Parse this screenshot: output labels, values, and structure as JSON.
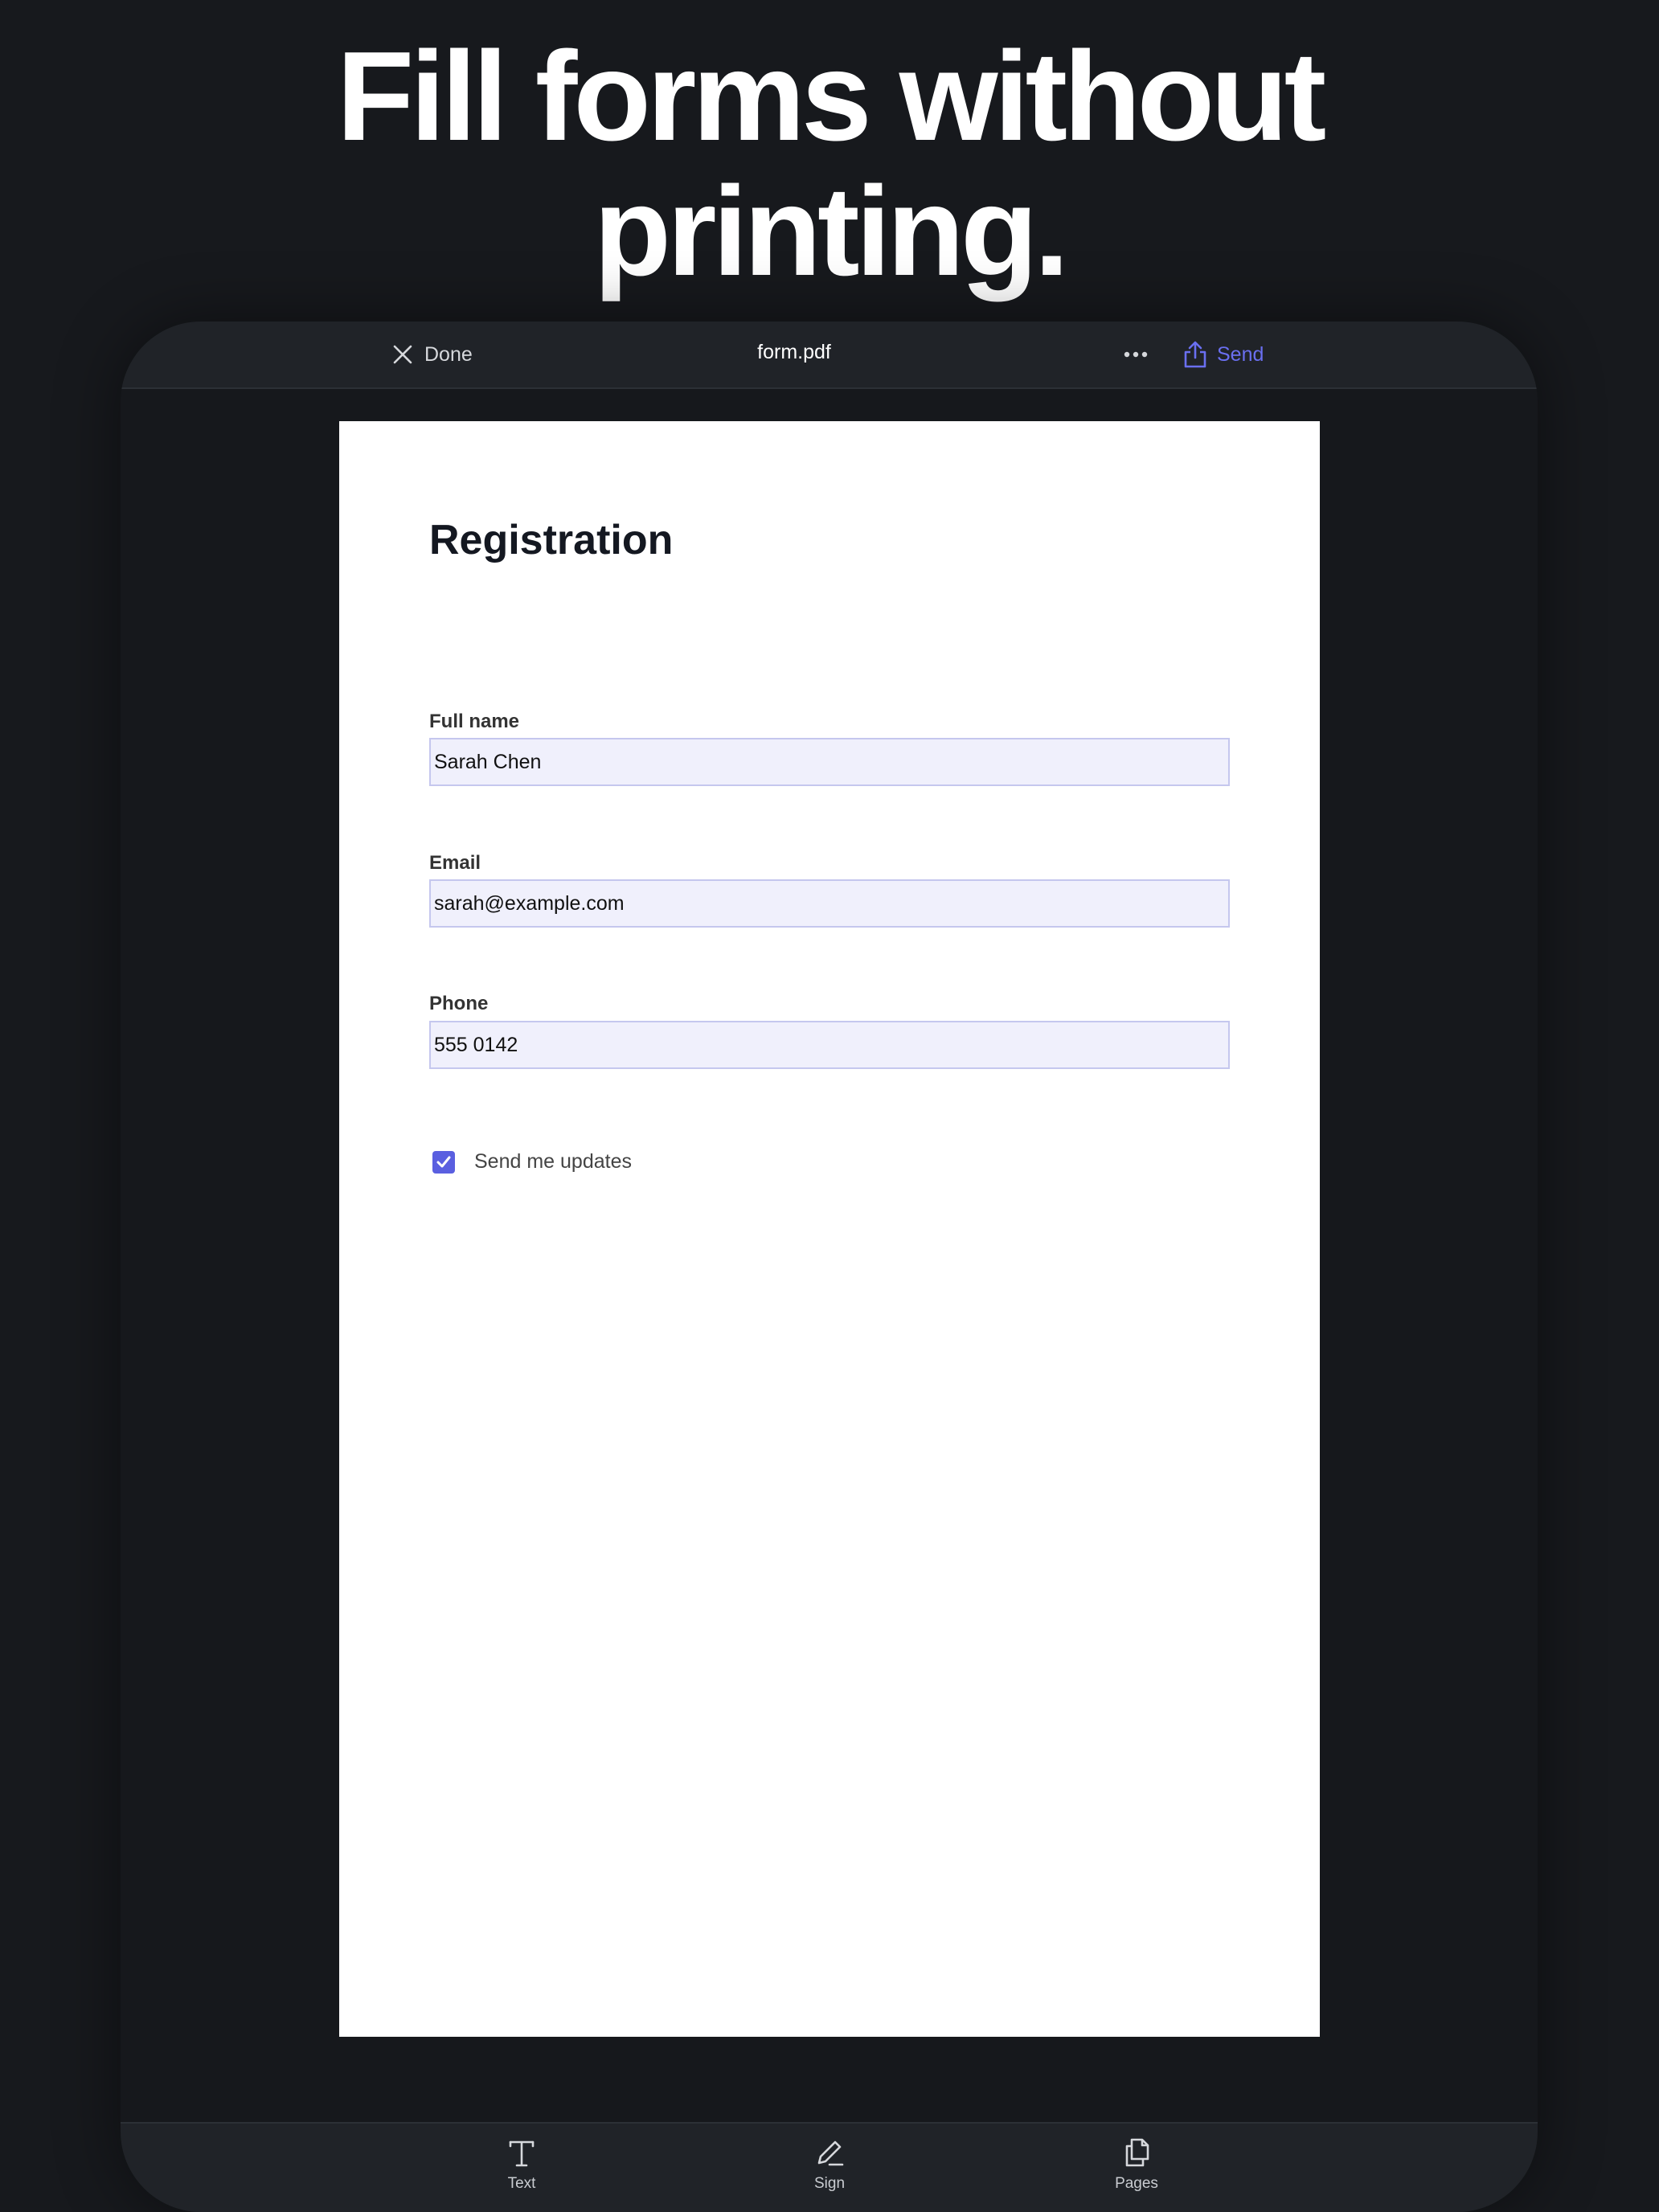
{
  "headline": {
    "line1": "Fill forms without",
    "line2": "printing."
  },
  "topbar": {
    "done_label": "Done",
    "document_title": "form.pdf",
    "more_icon": "ellipsis-icon",
    "send_label": "Send"
  },
  "form": {
    "title": "Registration",
    "fields": [
      {
        "label": "Full name",
        "value": "Sarah Chen"
      },
      {
        "label": "Email",
        "value": "sarah@example.com"
      },
      {
        "label": "Phone",
        "value": "555 0142"
      }
    ],
    "checkbox": {
      "label": "Send me updates",
      "checked": true
    }
  },
  "toolbar": {
    "items": [
      {
        "label": "Text",
        "icon": "text-icon"
      },
      {
        "label": "Sign",
        "icon": "pen-icon"
      },
      {
        "label": "Pages",
        "icon": "pages-icon"
      }
    ]
  },
  "colors": {
    "accent": "#5a5fe0",
    "field_fill": "#f0f0fc",
    "background": "#17191d"
  }
}
